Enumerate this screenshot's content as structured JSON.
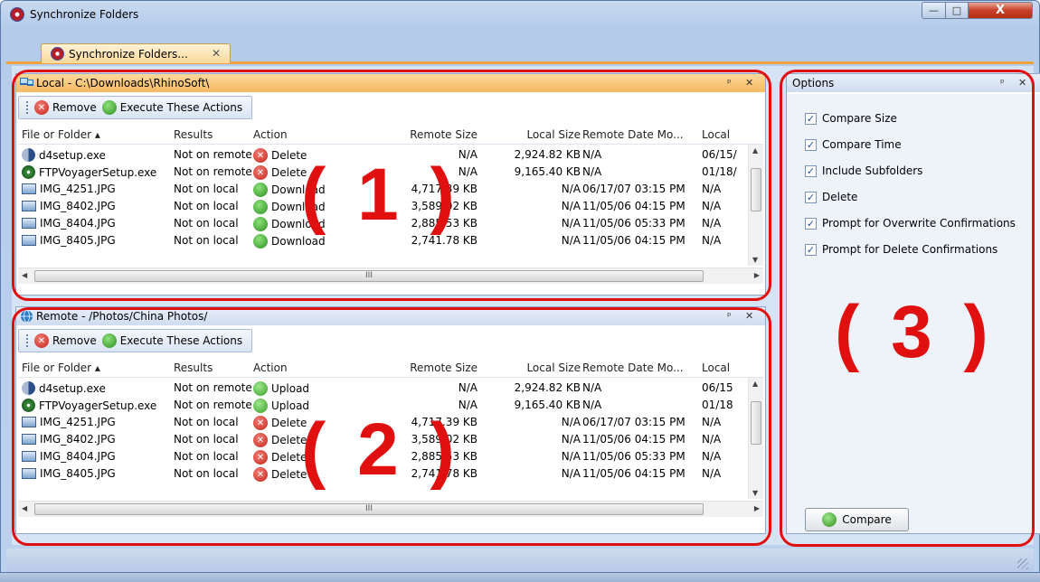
{
  "window": {
    "title": "Synchronize Folders",
    "tab_label": "Synchronize Folders...",
    "tab_close": "✕",
    "btn_minimize": "—",
    "btn_maximize": "□",
    "btn_close": "X"
  },
  "local_panel": {
    "title": "Local - C:\\Downloads\\RhinoSoft\\",
    "pin": "ᵖ",
    "close": "✕",
    "toolbar": {
      "remove_label": "Remove",
      "execute_label": "Execute These Actions"
    },
    "columns": [
      "File or Folder ▴",
      "Results",
      "Action",
      "Remote Size",
      "Local Size",
      "Remote Date Mo...",
      "Local"
    ],
    "rows": [
      {
        "icon": "exe-icon",
        "name": "d4setup.exe",
        "result": "Not on remote",
        "action_icon": "delete-icon",
        "action": "Delete",
        "remote_size": "N/A",
        "local_size": "2,924.82 KB",
        "remote_date": "N/A",
        "local_date": "06/15/"
      },
      {
        "icon": "ftp-icon",
        "name": "FTPVoyagerSetup.exe",
        "result": "Not on remote",
        "action_icon": "delete-icon",
        "action": "Delete",
        "remote_size": "N/A",
        "local_size": "9,165.40 KB",
        "remote_date": "N/A",
        "local_date": "01/18/"
      },
      {
        "icon": "image-icon",
        "name": "IMG_4251.JPG",
        "result": "Not on local",
        "action_icon": "download-icon",
        "action": "Download",
        "remote_size": "4,717.39 KB",
        "local_size": "N/A",
        "remote_date": "06/17/07 03:15 PM",
        "local_date": "N/A"
      },
      {
        "icon": "image-icon",
        "name": "IMG_8402.JPG",
        "result": "Not on local",
        "action_icon": "download-icon",
        "action": "Download",
        "remote_size": "3,589.02 KB",
        "local_size": "N/A",
        "remote_date": "11/05/06 04:15 PM",
        "local_date": "N/A"
      },
      {
        "icon": "image-icon",
        "name": "IMG_8404.JPG",
        "result": "Not on local",
        "action_icon": "download-icon",
        "action": "Download",
        "remote_size": "2,885.53 KB",
        "local_size": "N/A",
        "remote_date": "11/05/06 05:33 PM",
        "local_date": "N/A"
      },
      {
        "icon": "image-icon",
        "name": "IMG_8405.JPG",
        "result": "Not on local",
        "action_icon": "download-icon",
        "action": "Download",
        "remote_size": "2,741.78 KB",
        "local_size": "N/A",
        "remote_date": "11/05/06 04:15 PM",
        "local_date": "N/A"
      }
    ],
    "annotation": "( 1 )"
  },
  "remote_panel": {
    "title": "Remote - /Photos/China Photos/",
    "pin": "ᵖ",
    "close": "✕",
    "toolbar": {
      "remove_label": "Remove",
      "execute_label": "Execute These Actions"
    },
    "columns": [
      "File or Folder ▴",
      "Results",
      "Action",
      "Remote Size",
      "Local Size",
      "Remote Date Mo...",
      "Local"
    ],
    "rows": [
      {
        "icon": "exe-icon",
        "name": "d4setup.exe",
        "result": "Not on remote",
        "action_icon": "upload-icon",
        "action": "Upload",
        "remote_size": "N/A",
        "local_size": "2,924.82 KB",
        "remote_date": "N/A",
        "local_date": "06/15"
      },
      {
        "icon": "ftp-icon",
        "name": "FTPVoyagerSetup.exe",
        "result": "Not on remote",
        "action_icon": "upload-icon",
        "action": "Upload",
        "remote_size": "N/A",
        "local_size": "9,165.40 KB",
        "remote_date": "N/A",
        "local_date": "01/18"
      },
      {
        "icon": "image-icon",
        "name": "IMG_4251.JPG",
        "result": "Not on local",
        "action_icon": "delete-icon",
        "action": "Delete",
        "remote_size": "4,717.39 KB",
        "local_size": "N/A",
        "remote_date": "06/17/07 03:15 PM",
        "local_date": "N/A"
      },
      {
        "icon": "image-icon",
        "name": "IMG_8402.JPG",
        "result": "Not on local",
        "action_icon": "delete-icon",
        "action": "Delete",
        "remote_size": "3,589.02 KB",
        "local_size": "N/A",
        "remote_date": "11/05/06 04:15 PM",
        "local_date": "N/A"
      },
      {
        "icon": "image-icon",
        "name": "IMG_8404.JPG",
        "result": "Not on local",
        "action_icon": "delete-icon",
        "action": "Delete",
        "remote_size": "2,885.53 KB",
        "local_size": "N/A",
        "remote_date": "11/05/06 05:33 PM",
        "local_date": "N/A"
      },
      {
        "icon": "image-icon",
        "name": "IMG_8405.JPG",
        "result": "Not on local",
        "action_icon": "delete-icon",
        "action": "Delete",
        "remote_size": "2,741.78 KB",
        "local_size": "N/A",
        "remote_date": "11/05/06 04:15 PM",
        "local_date": "N/A"
      }
    ],
    "annotation": "( 2 )"
  },
  "options_panel": {
    "title": "Options",
    "pin": "ᵖ",
    "close": "✕",
    "items": [
      {
        "label": "Compare Size",
        "checked": true
      },
      {
        "label": "Compare Time",
        "checked": true
      },
      {
        "label": "Include Subfolders",
        "checked": true
      },
      {
        "label": "Delete",
        "checked": true
      },
      {
        "label": "Prompt for Overwrite Confirmations",
        "checked": true
      },
      {
        "label": "Prompt for Delete Confirmations",
        "checked": true
      }
    ],
    "compare_label": "Compare",
    "annotation": "( 3 )"
  },
  "scroll": {
    "thumb_grip": "III"
  },
  "colors": {
    "annotation_red": "#e01010",
    "local_header": "#f5b962",
    "remote_header": "#cfdcef"
  }
}
